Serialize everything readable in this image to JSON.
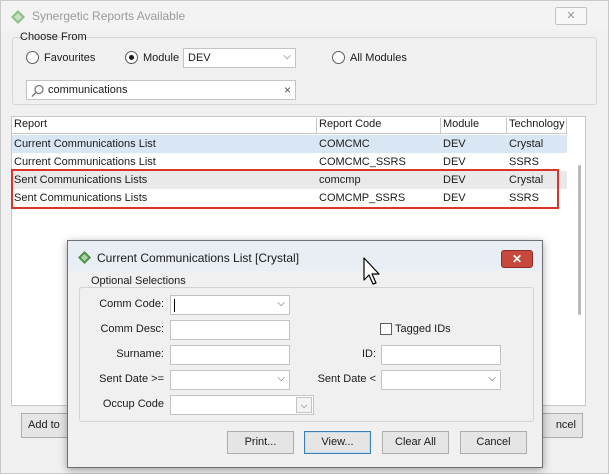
{
  "main_window": {
    "title": "Synergetic Reports Available",
    "close_label": "✕",
    "choose_from_label": "Choose From",
    "radios": [
      {
        "label": "Favourites",
        "selected": false
      },
      {
        "label": "Module",
        "selected": true
      },
      {
        "label": "All Modules",
        "selected": false
      }
    ],
    "module_value": "DEV",
    "search_value": "communications",
    "search_clear": "×",
    "columns": [
      "Report",
      "Report Code",
      "Module",
      "Technology"
    ],
    "rows": [
      {
        "report": "Current Communications List",
        "code": "COMCMC",
        "module": "DEV",
        "technology": "Crystal"
      },
      {
        "report": "Current Communications List",
        "code": "COMCMC_SSRS",
        "module": "DEV",
        "technology": "SSRS"
      },
      {
        "report": "Sent Communications Lists",
        "code": "comcmp",
        "module": "DEV",
        "technology": "Crystal"
      },
      {
        "report": "Sent Communications Lists",
        "code": "COMCMP_SSRS",
        "module": "DEV",
        "technology": "SSRS"
      }
    ],
    "highlight_color": "#d9352b",
    "bottom_buttons": {
      "add": "Add to",
      "cancel": "ncel"
    }
  },
  "dialog": {
    "title": "Current Communications List  [Crystal]",
    "close_label": "✕",
    "group_label": "Optional Selections",
    "fields": {
      "comm_code": {
        "label": "Comm Code:",
        "value": ""
      },
      "comm_desc": {
        "label": "Comm Desc:",
        "value": ""
      },
      "surname": {
        "label": "Surname:",
        "value": ""
      },
      "sent_date_from": {
        "label": "Sent Date >=",
        "value": ""
      },
      "occup_code": {
        "label": "Occup Code",
        "value": ""
      },
      "tagged_ids": {
        "label": "Tagged IDs",
        "checked": false
      },
      "id": {
        "label": "ID:",
        "value": ""
      },
      "sent_date_to": {
        "label": "Sent Date <",
        "value": ""
      }
    },
    "buttons": {
      "print": "Print...",
      "view": "View...",
      "clear_all": "Clear All",
      "cancel": "Cancel"
    }
  },
  "colors": {
    "selected_row": "#d9e6f3",
    "dialog_close": "#c7483c"
  }
}
